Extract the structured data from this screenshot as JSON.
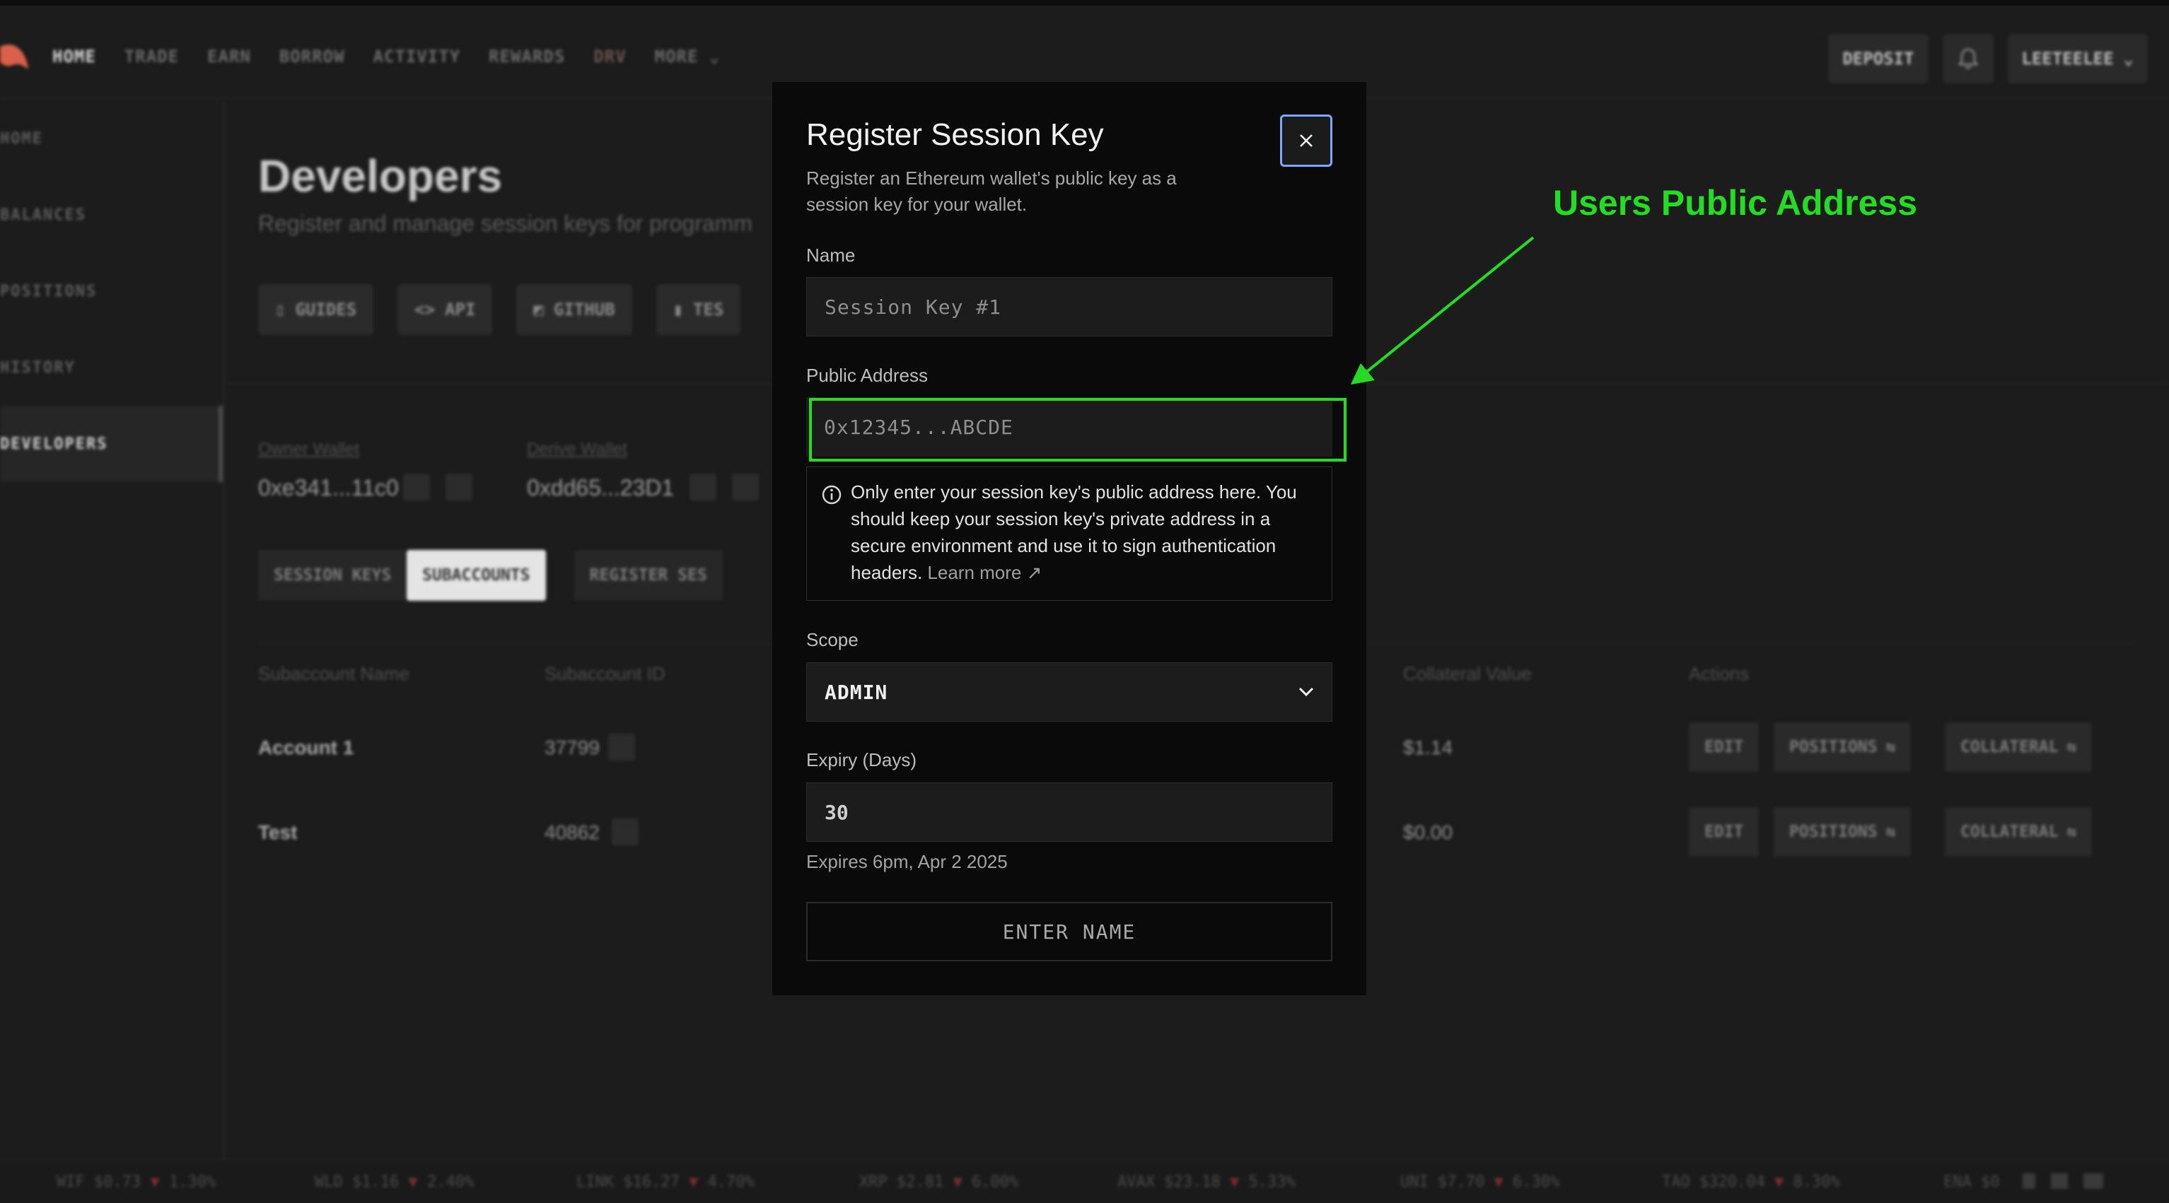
{
  "nav": {
    "items": [
      "HOME",
      "TRADE",
      "EARN",
      "BORROW",
      "ACTIVITY",
      "REWARDS",
      "DRV",
      "MORE"
    ],
    "deposit": "DEPOSIT",
    "user": "LEETEELEE"
  },
  "sidebar": {
    "items": [
      "HOME",
      "BALANCES",
      "POSITIONS",
      "HISTORY",
      "DEVELOPERS"
    ]
  },
  "page": {
    "title": "Developers",
    "subtitle": "Register and manage session keys for programm",
    "links": [
      "GUIDES",
      "API",
      "GITHUB",
      "TES"
    ],
    "owner_wallet_label": "Owner Wallet",
    "owner_wallet": "0xe341...11c0",
    "derive_wallet_label": "Derive Wallet",
    "derive_wallet": "0xdd65...23D1",
    "tabs": [
      "SESSION KEYS",
      "SUBACCOUNTS",
      "REGISTER SES"
    ],
    "table": {
      "headers": [
        "Subaccount Name",
        "Subaccount ID",
        "Collateral Value",
        "Actions"
      ],
      "rows": [
        {
          "name": "Account 1",
          "id": "37799",
          "collateral": "$1.14"
        },
        {
          "name": "Test",
          "id": "40862",
          "collateral": "$0.00"
        }
      ],
      "actions": [
        "EDIT",
        "POSITIONS",
        "COLLATERAL"
      ]
    }
  },
  "modal": {
    "title": "Register Session Key",
    "description": "Register an Ethereum wallet's public key as a session key for your wallet.",
    "name_label": "Name",
    "name_placeholder": "Session Key #1",
    "address_label": "Public Address",
    "address_placeholder": "0x12345...ABCDE",
    "info_text": "Only enter your session key's public address here. You should keep your session key's private address in a secure environment and use it to sign authentication headers.",
    "info_link": "Learn more ↗",
    "scope_label": "Scope",
    "scope_value": "ADMIN",
    "expiry_label": "Expiry (Days)",
    "expiry_value": "30",
    "expires_text": "Expires 6pm, Apr 2 2025",
    "submit_label": "ENTER NAME"
  },
  "annotation": {
    "text": "Users Public Address",
    "color": "#22dd22"
  },
  "ticker": [
    {
      "sym": "WIF",
      "price": "$0.73",
      "chg": "1.30%"
    },
    {
      "sym": "WLD",
      "price": "$1.16",
      "chg": "2.40%"
    },
    {
      "sym": "LINK",
      "price": "$16.27",
      "chg": "4.70%"
    },
    {
      "sym": "XRP",
      "price": "$2.81",
      "chg": "6.00%"
    },
    {
      "sym": "AVAX",
      "price": "$23.18",
      "chg": "5.33%"
    },
    {
      "sym": "UNI",
      "price": "$7.70",
      "chg": "6.30%"
    },
    {
      "sym": "TAO",
      "price": "$320.04",
      "chg": "8.30%"
    },
    {
      "sym": "ENA",
      "price": "$0",
      "chg": ""
    }
  ],
  "colors": {
    "accent_green": "#22dd22",
    "focus_blue": "#7ea6ff",
    "modal_bg": "#0a0a0a"
  }
}
